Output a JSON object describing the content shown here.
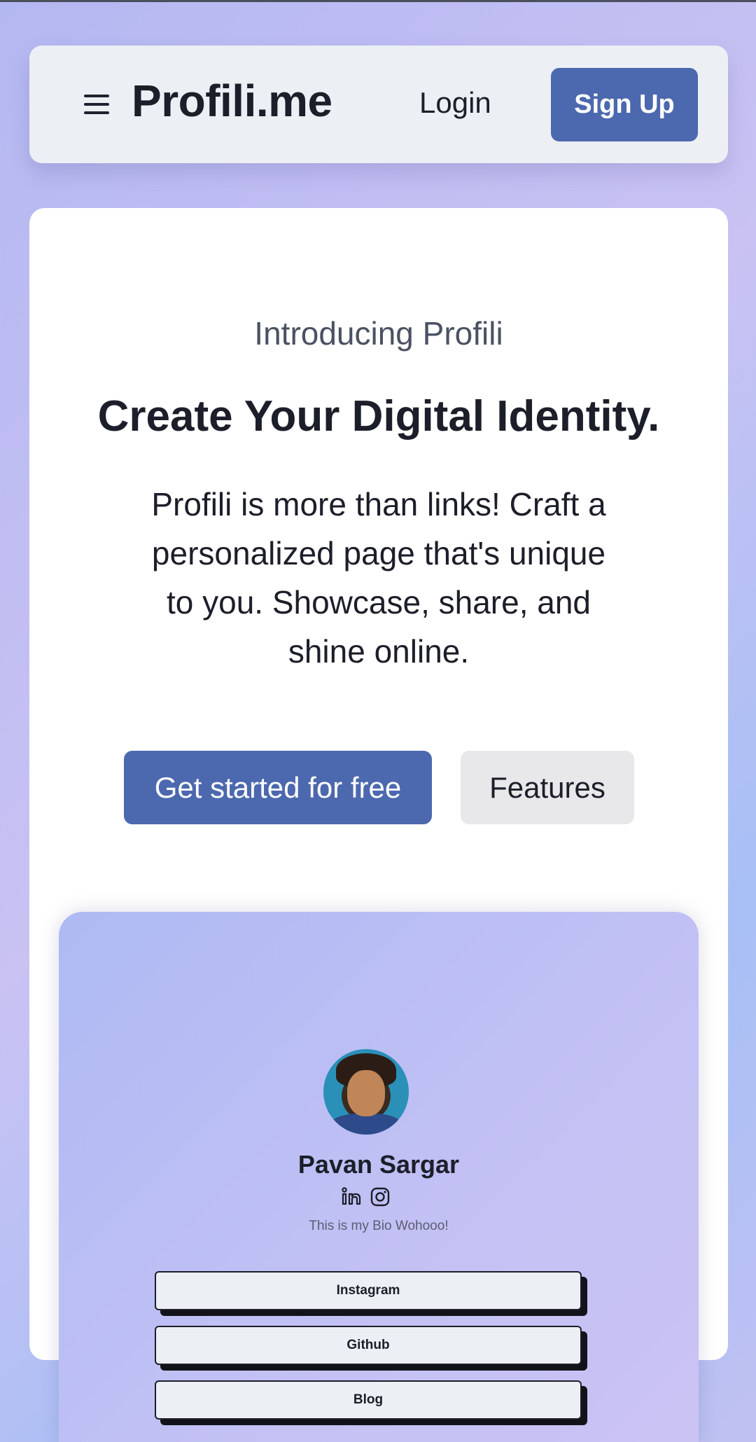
{
  "navbar": {
    "brand": "Profili.me",
    "login_label": "Login",
    "signup_label": "Sign Up",
    "menu_icon": "hamburger-menu-icon"
  },
  "hero": {
    "eyebrow": "Introducing Profili",
    "headline": "Create Your Digital Identity.",
    "description": "Profili is more than links! Craft a personalized page that's unique to you. Showcase, share, and shine online.",
    "primary_cta": "Get started for free",
    "secondary_cta": "Features"
  },
  "preview": {
    "name": "Pavan Sargar",
    "bio": "This is my Bio Wohooo!",
    "social_icons": [
      "linkedin-icon",
      "instagram-icon"
    ],
    "links": [
      "Instagram",
      "Github",
      "Blog"
    ]
  },
  "colors": {
    "accent": "#4c68ae",
    "text": "#1c1e29",
    "navbar_bg": "#eceff4",
    "secondary_button_bg": "#e8e8ea"
  }
}
